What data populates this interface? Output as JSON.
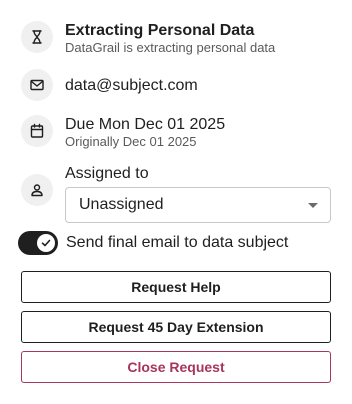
{
  "status": {
    "title": "Extracting Personal Data",
    "subtitle": "DataGrail is extracting personal data",
    "icon": "hourglass-icon"
  },
  "email": {
    "value": "data@subject.com",
    "icon": "mail-icon"
  },
  "due": {
    "title": "Due Mon Dec 01 2025",
    "subtitle": "Originally Dec 01 2025",
    "icon": "calendar-icon"
  },
  "assignee": {
    "label": "Assigned to",
    "value": "Unassigned",
    "icon": "user-icon"
  },
  "toggle": {
    "label": "Send final email to data subject",
    "checked": true
  },
  "buttons": {
    "request_help": "Request Help",
    "extension": "Request 45 Day Extension",
    "close": "Close Request"
  },
  "colors": {
    "danger": "#a8355a",
    "toggle_on": "#1f1f1f",
    "icon_bg": "#f0f0f0"
  }
}
